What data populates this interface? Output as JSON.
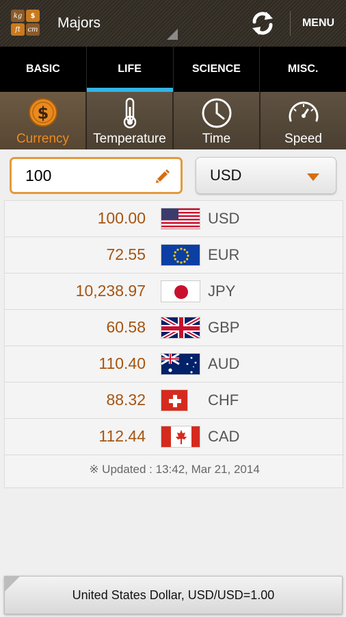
{
  "app": {
    "title": "Majors",
    "menu_label": "MENU",
    "icon_cells": [
      "kg",
      "$",
      "ft",
      "cm"
    ]
  },
  "tabs": [
    {
      "label": "BASIC",
      "active": false
    },
    {
      "label": "LIFE",
      "active": true
    },
    {
      "label": "SCIENCE",
      "active": false
    },
    {
      "label": "MISC.",
      "active": false
    }
  ],
  "categories": [
    {
      "label": "Currency",
      "icon": "dollar-coin-icon",
      "active": true
    },
    {
      "label": "Temperature",
      "icon": "thermometer-icon",
      "active": false
    },
    {
      "label": "Time",
      "icon": "clock-icon",
      "active": false
    },
    {
      "label": "Speed",
      "icon": "speedometer-icon",
      "active": false
    }
  ],
  "input": {
    "amount": "100",
    "selected_currency": "USD"
  },
  "rates": [
    {
      "value": "100.00",
      "code": "USD",
      "flag": "us-flag-icon"
    },
    {
      "value": "72.55",
      "code": "EUR",
      "flag": "eu-flag-icon"
    },
    {
      "value": "10,238.97",
      "code": "JPY",
      "flag": "japan-flag-icon"
    },
    {
      "value": "60.58",
      "code": "GBP",
      "flag": "uk-flag-icon"
    },
    {
      "value": "110.40",
      "code": "AUD",
      "flag": "australia-flag-icon"
    },
    {
      "value": "88.32",
      "code": "CHF",
      "flag": "swiss-flag-icon"
    },
    {
      "value": "112.44",
      "code": "CAD",
      "flag": "canada-flag-icon"
    }
  ],
  "updated_text": "※ Updated : 13:42, Mar 21, 2014",
  "bottom_bar": "United States Dollar, USD/USD=1.00",
  "colors": {
    "accent_orange": "#f08a1e",
    "value_brown": "#a65410",
    "tab_indicator": "#33b5e5"
  }
}
